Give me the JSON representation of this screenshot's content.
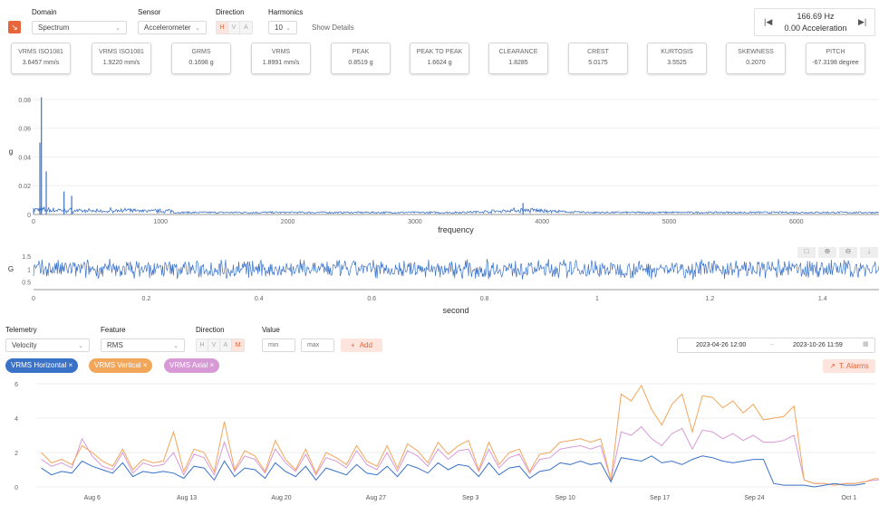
{
  "colors": {
    "accent": "#e8643a",
    "signal": "#3a72c8",
    "horizontal": "#3a72c8",
    "vertical": "#f2a65a",
    "axial": "#d79ad7"
  },
  "top": {
    "domain": {
      "label": "Domain",
      "value": "Spectrum"
    },
    "sensor": {
      "label": "Sensor",
      "value": "Accelerometer"
    },
    "direction": {
      "label": "Direction",
      "options": [
        "H",
        "V",
        "A"
      ],
      "active": "H"
    },
    "harmonics": {
      "label": "Harmonics",
      "value": "10"
    },
    "show_details": "Show Details",
    "nav": {
      "frequency": "166.69 Hz",
      "value": "0.00 Acceleration"
    }
  },
  "metrics": [
    {
      "title": "VRMS ISO1081",
      "value": "3.6457 mm/s"
    },
    {
      "title": "VRMS ISO1081",
      "value": "1.9220 mm/s"
    },
    {
      "title": "GRMS",
      "value": "0.1698 g"
    },
    {
      "title": "VRMS",
      "value": "1.8991 mm/s"
    },
    {
      "title": "PEAK",
      "value": "0.8519 g"
    },
    {
      "title": "PEAK TO PEAK",
      "value": "1.6624 g"
    },
    {
      "title": "CLEARANCE",
      "value": "1.8285"
    },
    {
      "title": "CREST",
      "value": "5.0175"
    },
    {
      "title": "KURTOSIS",
      "value": "3.5525"
    },
    {
      "title": "SKEWNESS",
      "value": "0.2070"
    },
    {
      "title": "PITCH",
      "value": "-67.3198 degree"
    }
  ],
  "spectrum_chart": {
    "ylabel": "g",
    "xlabel": "frequency",
    "y_ticks": [
      "0",
      "0.02",
      "0.04",
      "0.06",
      "0.08"
    ],
    "x_ticks": [
      "0",
      "1000",
      "2000",
      "3000",
      "4000",
      "5000",
      "6000"
    ],
    "x_range": [
      0,
      6650
    ],
    "y_range": [
      0,
      0.085
    ],
    "peaks": [
      {
        "x": 62,
        "y": 0.0815
      },
      {
        "x": 50,
        "y": 0.05
      },
      {
        "x": 100,
        "y": 0.03
      },
      {
        "x": 240,
        "y": 0.016
      },
      {
        "x": 300,
        "y": 0.013
      },
      {
        "x": 3850,
        "y": 0.008
      }
    ]
  },
  "time_chart": {
    "ylabel": "G",
    "xlabel": "second",
    "y_ticks": [
      "0.5",
      "1",
      "1.5"
    ],
    "x_ticks": [
      "0",
      "0.2",
      "0.4",
      "0.6",
      "0.8",
      "1",
      "1.2",
      "1.4"
    ],
    "x_range": [
      0,
      1.5
    ],
    "y_range": [
      0.2,
      1.75
    ],
    "mean": 1.0,
    "amplitude": 0.6
  },
  "trend_controls": {
    "telemetry": {
      "label": "Telemetry",
      "value": "Velocity"
    },
    "feature": {
      "label": "Feature",
      "value": "RMS"
    },
    "direction": {
      "label": "Direction",
      "options": [
        "H",
        "V",
        "A",
        "M"
      ],
      "active": "M"
    },
    "value": {
      "label": "Value",
      "min_placeholder": "min",
      "max_placeholder": "max"
    },
    "add_label": "Add",
    "date_from": "2023-04-26 12:00",
    "date_to": "2023-10-26 11:59",
    "alarms_label": "T. Alarms"
  },
  "tags": [
    {
      "label": "VRMS Horizontal",
      "color": "#3a72c8"
    },
    {
      "label": "VRMS Vertical",
      "color": "#f2a65a"
    },
    {
      "label": "VRMS Axial",
      "color": "#d79ad7"
    }
  ],
  "chart_data": {
    "type": "line",
    "title": "",
    "xlabel": "",
    "ylabel": "",
    "ylim": [
      0,
      6
    ],
    "y_ticks": [
      "0",
      "2",
      "4",
      "6"
    ],
    "x_tick_labels": [
      "Aug 6",
      "Aug 13",
      "Aug 20",
      "Aug 27",
      "Sep 3",
      "Sep 10",
      "Sep 17",
      "Sep 24",
      "Oct 1"
    ],
    "x_tick_index": [
      5,
      14.3,
      23.6,
      32.9,
      42.2,
      51.5,
      60.8,
      70.1,
      79.4
    ],
    "x_range": [
      -0.5,
      82
    ],
    "series": [
      {
        "name": "VRMS Horizontal",
        "color": "#3a72c8",
        "values": [
          1.1,
          0.7,
          0.9,
          0.8,
          1.5,
          1.2,
          1.0,
          0.8,
          1.4,
          0.6,
          0.9,
          0.8,
          0.9,
          0.8,
          0.5,
          1.2,
          1.1,
          0.4,
          1.5,
          0.6,
          1.1,
          1.0,
          0.5,
          1.4,
          0.9,
          0.6,
          1.2,
          0.4,
          1.1,
          0.9,
          0.7,
          1.3,
          0.8,
          0.7,
          1.2,
          0.6,
          1.3,
          1.1,
          0.8,
          1.4,
          1.0,
          1.3,
          1.2,
          0.6,
          1.4,
          0.7,
          1.1,
          1.2,
          0.5,
          0.9,
          1.0,
          1.4,
          1.3,
          1.5,
          1.3,
          1.4,
          0.3,
          1.7,
          1.6,
          1.5,
          1.8,
          1.4,
          1.5,
          1.3,
          1.6,
          1.8,
          1.7,
          1.5,
          1.4,
          1.5,
          1.6,
          1.6,
          0.2,
          0.1,
          0.1,
          0.1,
          0.0,
          0.1,
          0.2,
          0.1,
          0.1,
          0.2
        ]
      },
      {
        "name": "VRMS Vertical",
        "color": "#f2a65a",
        "values": [
          2.0,
          1.4,
          1.6,
          1.3,
          2.4,
          2.0,
          1.5,
          1.2,
          2.2,
          1.0,
          1.6,
          1.4,
          1.5,
          3.2,
          0.9,
          2.2,
          2.0,
          0.9,
          3.8,
          1.0,
          2.1,
          1.8,
          0.9,
          2.7,
          1.6,
          1.0,
          2.2,
          0.8,
          2.0,
          1.7,
          1.3,
          2.4,
          1.5,
          1.2,
          2.4,
          1.1,
          2.5,
          2.1,
          1.4,
          2.6,
          1.9,
          2.4,
          2.7,
          1.0,
          2.6,
          1.3,
          2.0,
          2.2,
          0.9,
          1.9,
          2.0,
          2.6,
          2.7,
          2.8,
          2.6,
          2.8,
          0.4,
          5.4,
          5.0,
          5.9,
          4.5,
          3.6,
          4.8,
          5.4,
          3.2,
          5.3,
          5.2,
          4.6,
          5.0,
          4.3,
          4.8,
          3.9,
          4.0,
          4.1,
          4.7,
          0.4,
          0.2,
          0.2,
          0.1,
          0.2,
          0.2,
          0.3,
          0.5,
          0.4,
          0.5,
          0.5
        ]
      },
      {
        "name": "VRMS Axial",
        "color": "#d79ad7",
        "values": [
          1.6,
          1.2,
          1.4,
          1.1,
          2.8,
          1.8,
          1.2,
          1.0,
          2.0,
          0.8,
          1.4,
          1.2,
          1.3,
          2.0,
          0.7,
          1.9,
          1.7,
          0.7,
          2.6,
          0.9,
          1.8,
          1.6,
          0.8,
          2.2,
          1.4,
          0.9,
          1.9,
          0.7,
          1.7,
          1.5,
          1.1,
          2.1,
          1.3,
          1.0,
          2.0,
          0.9,
          2.1,
          1.8,
          1.2,
          2.2,
          1.6,
          2.1,
          2.2,
          0.9,
          2.2,
          1.1,
          1.7,
          1.9,
          0.8,
          1.6,
          1.7,
          2.2,
          2.3,
          2.4,
          2.2,
          2.4,
          0.4,
          3.2,
          3.0,
          3.5,
          2.8,
          2.4,
          3.1,
          3.4,
          2.2,
          3.3,
          3.2,
          2.8,
          3.1,
          2.7,
          3.0,
          2.6,
          2.6,
          2.7,
          3.0,
          0.4,
          0.2,
          0.2,
          0.1,
          0.2,
          0.2,
          0.3,
          0.4,
          0.4,
          0.4,
          0.4
        ]
      }
    ]
  }
}
